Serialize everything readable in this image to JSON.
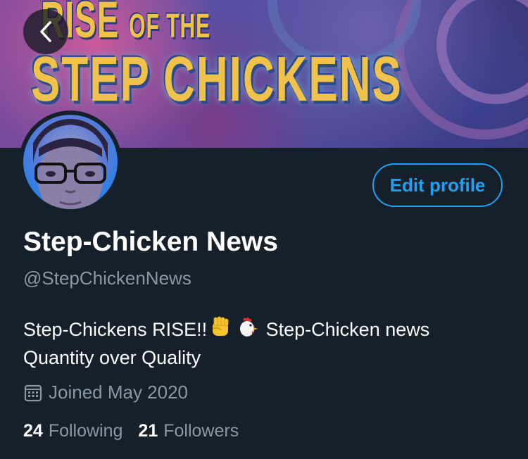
{
  "banner": {
    "title_top": "RISE",
    "title_of_the": "OF THE",
    "title_main": "STEP CHICKENS"
  },
  "header": {
    "back_icon": "chevron-left-icon"
  },
  "profile": {
    "edit_label": "Edit profile",
    "display_name": "Step-Chicken News",
    "handle": "@StepChickenNews",
    "bio_line1_a": "Step-Chickens RISE!!",
    "bio_line1_emoji1": "raised-fist-emoji",
    "bio_line1_emoji2": "chicken-emoji",
    "bio_line1_b": "Step-Chicken news",
    "bio_line2": "Quantity over Quality",
    "joined_icon": "calendar-icon",
    "joined": "Joined May 2020",
    "following_count": "24",
    "following_label": "Following",
    "followers_count": "21",
    "followers_label": "Followers"
  },
  "colors": {
    "background": "#15202b",
    "accent": "#1da1f2",
    "secondary_text": "#8899a6",
    "primary_text": "#ffffff"
  }
}
